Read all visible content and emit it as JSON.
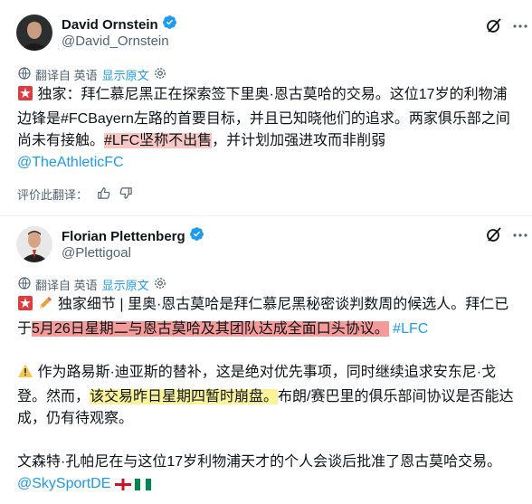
{
  "tweet1": {
    "author_name": "David Ornstein",
    "author_handle": "@David_Ornstein",
    "translate_label": "翻译自 英语",
    "show_original_label": "显示原文",
    "text_prefix": "独家：拜仁慕尼黑正在探索签下里奥·恩古莫哈的交易。这位17岁的利物浦边锋是#FCBayern左路的首要目标，并且已知晓他们的追求。两家俱乐部之间尚未有接触。",
    "text_highlight": "#LFC坚称不出售",
    "text_suffix": "，并计划加强进攻而非削弱",
    "link": "@TheAthleticFC",
    "rate_label": "评价此翻译："
  },
  "tweet2": {
    "author_name": "Florian Plettenberg",
    "author_handle": "@Plettigoal",
    "translate_label": "翻译自 英语",
    "show_original_label": "显示原文",
    "para1_prefix": "独家细节 | 里奥·恩古莫哈是拜仁慕尼黑秘密谈判数周的候选人。拜仁已于",
    "para1_highlight": "5月26日星期二与恩古莫哈及其团队达成全面口头协议。",
    "para1_tag": "#LFC",
    "para2_prefix": "作为路易斯·迪亚斯的替补，这是绝对优先事项，同时继续追求安东尼·戈登。然而，",
    "para2_highlight": "该交易昨日星期四暂时崩盘。",
    "para2_suffix": "布朗/赛巴里的俱乐部间协议是否能达成，仍有待观察。",
    "para3": "文森特·孔帕尼在与这位17岁利物浦天才的个人会谈后批准了恩古莫哈交易。",
    "link": "@SkySportDE"
  },
  "icons": {
    "verified": "verified-badge-icon",
    "grok": "grok-icon",
    "more": "more-icon",
    "translate": "translate-icon",
    "settings": "gear-icon",
    "thumbs_up": "thumbs-up-icon",
    "thumbs_down": "thumbs-down-icon",
    "siren": "siren-emoji",
    "pencil": "pencil-emoji",
    "warning": "warning-emoji",
    "england_flag": "england-flag-emoji",
    "nigeria_flag": "nigeria-flag-emoji"
  },
  "colors": {
    "link": "#1d9bf0",
    "verified": "#1d9bf0",
    "highlight_red": "#f8c9c4",
    "highlight_red_strong": "#f49a99",
    "highlight_yellow": "#fbf39a",
    "muted": "#536471"
  }
}
